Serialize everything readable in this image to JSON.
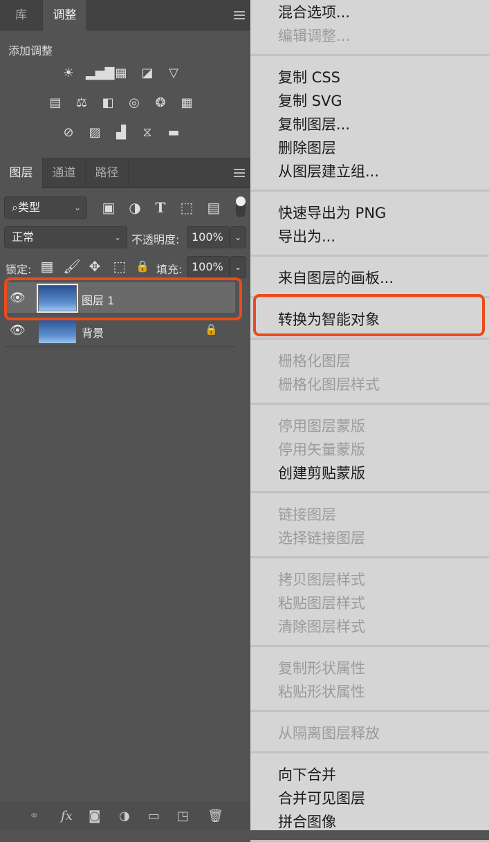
{
  "adjust_panel": {
    "tabs": [
      "库",
      "调整"
    ],
    "title": "添加调整",
    "icons": [
      [
        "brightness-contrast-icon",
        "levels-icon",
        "curves-icon",
        "exposure-icon",
        "vibrance-icon"
      ],
      [
        "hue-saturation-icon",
        "color-balance-icon",
        "black-white-icon",
        "photo-filter-icon",
        "channel-mixer-icon",
        "color-lookup-icon"
      ],
      [
        "invert-icon",
        "posterize-icon",
        "threshold-icon",
        "selective-color-icon",
        "gradient-map-icon"
      ]
    ]
  },
  "layers_panel": {
    "tabs": [
      "图层",
      "通道",
      "路径"
    ],
    "filter": "类型",
    "blend_mode": "正常",
    "opacity_label": "不透明度:",
    "opacity": "100%",
    "lock_label": "锁定:",
    "fill_label": "填充:",
    "fill": "100%",
    "layers": [
      {
        "name": "图层 1",
        "selected": true
      },
      {
        "name": "背景",
        "locked": true
      }
    ]
  },
  "menu": {
    "groups": [
      [
        {
          "label": "混合选项...",
          "enabled": true
        },
        {
          "label": "编辑调整...",
          "enabled": false
        }
      ],
      [
        {
          "label": "复制 CSS",
          "enabled": true
        },
        {
          "label": "复制 SVG",
          "enabled": true
        },
        {
          "label": "复制图层...",
          "enabled": true
        },
        {
          "label": "删除图层",
          "enabled": true
        },
        {
          "label": "从图层建立组...",
          "enabled": true
        }
      ],
      [
        {
          "label": "快速导出为 PNG",
          "enabled": true
        },
        {
          "label": "导出为...",
          "enabled": true
        }
      ],
      [
        {
          "label": "来自图层的画板...",
          "enabled": true
        }
      ],
      [
        {
          "label": "转换为智能对象",
          "enabled": true
        }
      ],
      [
        {
          "label": "栅格化图层",
          "enabled": false
        },
        {
          "label": "栅格化图层样式",
          "enabled": false
        }
      ],
      [
        {
          "label": "停用图层蒙版",
          "enabled": false
        },
        {
          "label": "停用矢量蒙版",
          "enabled": false
        },
        {
          "label": "创建剪贴蒙版",
          "enabled": true
        }
      ],
      [
        {
          "label": "链接图层",
          "enabled": false
        },
        {
          "label": "选择链接图层",
          "enabled": false
        }
      ],
      [
        {
          "label": "拷贝图层样式",
          "enabled": false
        },
        {
          "label": "粘贴图层样式",
          "enabled": false
        },
        {
          "label": "清除图层样式",
          "enabled": false
        }
      ],
      [
        {
          "label": "复制形状属性",
          "enabled": false
        },
        {
          "label": "粘贴形状属性",
          "enabled": false
        }
      ],
      [
        {
          "label": "从隔离图层释放",
          "enabled": false
        }
      ],
      [
        {
          "label": "向下合并",
          "enabled": true
        },
        {
          "label": "合并可见图层",
          "enabled": true
        },
        {
          "label": "拼合图像",
          "enabled": true
        }
      ]
    ]
  },
  "highlight_color": "#ec4a1c"
}
